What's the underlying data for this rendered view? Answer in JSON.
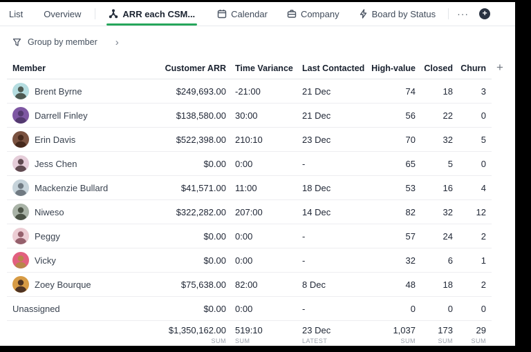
{
  "tabbar": {
    "tabs": [
      {
        "label": "List",
        "icon": null,
        "active": false
      },
      {
        "label": "Overview",
        "icon": null,
        "active": false
      },
      {
        "label": "ARR each CSM...",
        "icon": "workflow-icon",
        "active": true
      },
      {
        "label": "Calendar",
        "icon": "calendar-icon",
        "active": false
      },
      {
        "label": "Company",
        "icon": "briefcase-icon",
        "active": false
      },
      {
        "label": "Board by Status",
        "icon": "lightning-icon",
        "active": false
      }
    ],
    "more_label": "···",
    "add_view_label": "+"
  },
  "toolbar": {
    "group_by_label": "Group by member",
    "chevron": "›"
  },
  "colors": {
    "accent_green": "#26a65b",
    "add_view_circle": "#2a3342"
  },
  "icons": {
    "active_tab": "workflow-icon",
    "calendar": "calendar-icon",
    "company": "briefcase-icon",
    "board": "lightning-icon",
    "filter": "funnel-icon",
    "chevron": "chevron-right-icon",
    "more": "ellipsis-icon",
    "add": "plus-icon"
  },
  "table": {
    "columns": [
      {
        "label": "Member",
        "align": "left"
      },
      {
        "label": "Customer ARR",
        "align": "right"
      },
      {
        "label": "Time Variance",
        "align": "left"
      },
      {
        "label": "Last Contacted",
        "align": "left"
      },
      {
        "label": "High-value",
        "align": "right"
      },
      {
        "label": "Closed",
        "align": "right"
      },
      {
        "label": "Churn",
        "align": "right"
      }
    ],
    "add_column_label": "+",
    "rows": [
      {
        "member": "Brent Byrne",
        "avatar": {
          "bg": "#b5dde0",
          "fg": "#4e5a52"
        },
        "customer_arr": "$249,693.00",
        "time_variance": "-21:00",
        "last_contacted": "21 Dec",
        "high_value": "74",
        "closed": "18",
        "churn": "3"
      },
      {
        "member": "Darrell Finley",
        "avatar": {
          "bg": "#7e57a3",
          "fg": "#53396f"
        },
        "customer_arr": "$138,580.00",
        "time_variance": "30:00",
        "last_contacted": "21 Dec",
        "high_value": "56",
        "closed": "22",
        "churn": "0"
      },
      {
        "member": "Erin Davis",
        "avatar": {
          "bg": "#7a5240",
          "fg": "#46291c"
        },
        "customer_arr": "$522,398.00",
        "time_variance": "210:10",
        "last_contacted": "23 Dec",
        "high_value": "70",
        "closed": "32",
        "churn": "5"
      },
      {
        "member": "Jess Chen",
        "avatar": {
          "bg": "#e5cdd9",
          "fg": "#604a50"
        },
        "customer_arr": "$0.00",
        "time_variance": "0:00",
        "last_contacted": "-",
        "high_value": "65",
        "closed": "5",
        "churn": "0"
      },
      {
        "member": "Mackenzie Bullard",
        "avatar": {
          "bg": "#c6d3da",
          "fg": "#707a82"
        },
        "customer_arr": "$41,571.00",
        "time_variance": "11:00",
        "last_contacted": "18 Dec",
        "high_value": "53",
        "closed": "16",
        "churn": "4"
      },
      {
        "member": "Niweso",
        "avatar": {
          "bg": "#a9b3a7",
          "fg": "#4b5346"
        },
        "customer_arr": "$322,282.00",
        "time_variance": "207:00",
        "last_contacted": "14 Dec",
        "high_value": "82",
        "closed": "32",
        "churn": "12"
      },
      {
        "member": "Peggy",
        "avatar": {
          "bg": "#eccdd4",
          "fg": "#95606c"
        },
        "customer_arr": "$0.00",
        "time_variance": "0:00",
        "last_contacted": "-",
        "high_value": "57",
        "closed": "24",
        "churn": "2"
      },
      {
        "member": "Vicky",
        "avatar": {
          "bg": "#e2607f",
          "fg": "#b8864a"
        },
        "customer_arr": "$0.00",
        "time_variance": "0:00",
        "last_contacted": "-",
        "high_value": "32",
        "closed": "6",
        "churn": "1"
      },
      {
        "member": "Zoey Bourque",
        "avatar": {
          "bg": "#d79b45",
          "fg": "#4e3322"
        },
        "customer_arr": "$75,638.00",
        "time_variance": "82:00",
        "last_contacted": "8 Dec",
        "high_value": "48",
        "closed": "18",
        "churn": "2"
      },
      {
        "member": "Unassigned",
        "avatar": null,
        "customer_arr": "$0.00",
        "time_variance": "0:00",
        "last_contacted": "-",
        "high_value": "0",
        "closed": "0",
        "churn": "0"
      }
    ],
    "footer": {
      "customer_arr": {
        "value": "$1,350,162.00",
        "label": "SUM"
      },
      "time_variance": {
        "value": "519:10",
        "label": "SUM"
      },
      "last_contacted": {
        "value": "23 Dec",
        "label": "LATEST"
      },
      "high_value": {
        "value": "1,037",
        "label": "SUM"
      },
      "closed": {
        "value": "173",
        "label": "SUM"
      },
      "churn": {
        "value": "29",
        "label": "SUM"
      }
    }
  }
}
